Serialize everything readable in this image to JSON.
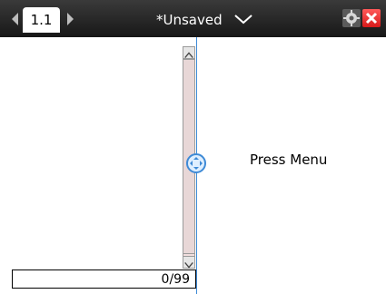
{
  "topbar": {
    "tab_label": "1.1",
    "document_title": "*Unsaved"
  },
  "icons": {
    "tab_prev": "triangle-left-icon",
    "tab_next": "triangle-right-icon",
    "doc_menu": "chevron-down-icon",
    "settings": "gear-icon",
    "close": "close-icon",
    "scroll_up": "arrow-up-icon",
    "scroll_down": "arrow-down-icon",
    "divider_handle": "move-handle-icon"
  },
  "left_pane": {
    "counter": "0/99"
  },
  "right_pane": {
    "message": "Press Menu"
  },
  "colors": {
    "topbar_bg": "#1f1f1f",
    "divider": "#3e8ad6",
    "close_button": "#e02828"
  }
}
